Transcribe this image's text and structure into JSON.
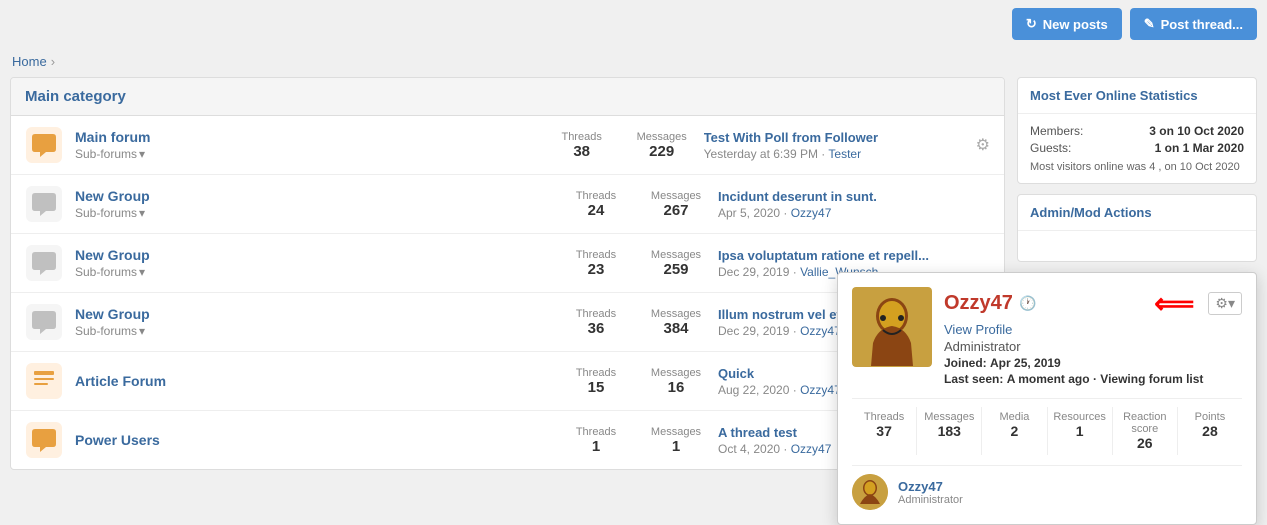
{
  "breadcrumb": {
    "home_label": "Home",
    "separator": "›"
  },
  "buttons": {
    "new_posts": "New posts",
    "post_thread": "Post thread..."
  },
  "category": {
    "title": "Main category",
    "forums": [
      {
        "id": "main-forum",
        "icon_type": "chat-orange",
        "title": "Main forum",
        "has_subforums": true,
        "threads": "38",
        "messages": "229",
        "latest_title": "Test With Poll from Follower",
        "latest_meta": "Yesterday at 6:39 PM",
        "latest_user": "Tester"
      },
      {
        "id": "new-group-1",
        "icon_type": "chat-gray",
        "title": "New Group",
        "has_subforums": true,
        "threads": "24",
        "messages": "267",
        "latest_title": "Incidunt deserunt in sunt.",
        "latest_meta": "Apr 5, 2020",
        "latest_user": "Ozzy47"
      },
      {
        "id": "new-group-2",
        "icon_type": "chat-gray",
        "title": "New Group",
        "has_subforums": true,
        "threads": "23",
        "messages": "259",
        "latest_title": "Ipsa voluptatum ratione et repell...",
        "latest_meta": "Dec 29, 2019",
        "latest_user": "Vallie_Wunsch"
      },
      {
        "id": "new-group-3",
        "icon_type": "chat-gray",
        "title": "New Group",
        "has_subforums": true,
        "threads": "36",
        "messages": "384",
        "latest_title": "Illum nostrum vel et eaque ipsum",
        "latest_meta": "Dec 29, 2019",
        "latest_user": "Ozzy47"
      },
      {
        "id": "article-forum",
        "icon_type": "article-orange",
        "title": "Article Forum",
        "has_subforums": false,
        "threads": "15",
        "messages": "16",
        "latest_title": "Quick",
        "latest_meta": "Aug 22, 2020",
        "latest_user": "Ozzy47"
      },
      {
        "id": "power-users",
        "icon_type": "chat-orange",
        "title": "Power Users",
        "has_subforums": false,
        "threads": "1",
        "messages": "1",
        "latest_title": "A thread test",
        "latest_meta": "Oct 4, 2020",
        "latest_user": "Ozzy47"
      }
    ]
  },
  "sidebar": {
    "online_stats": {
      "title": "Most Ever Online Statistics",
      "members_label": "Members:",
      "members_value": "3 on 10 Oct 2020",
      "guests_label": "Guests:",
      "guests_value": "1 on 1 Mar 2020",
      "most_visitors": "Most visitors online was 4 , on 10 Oct 2020"
    },
    "admin_actions": {
      "title": "Admin/Mod Actions"
    }
  },
  "popup": {
    "username": "Ozzy47",
    "view_profile": "View Profile",
    "role": "Administrator",
    "joined_label": "Joined:",
    "joined_value": "Apr 25, 2019",
    "last_seen_label": "Last seen:",
    "last_seen_value": "A moment ago",
    "last_seen_suffix": "· Viewing forum list",
    "stats": [
      {
        "label": "Threads",
        "value": "37"
      },
      {
        "label": "Messages",
        "value": "183"
      },
      {
        "label": "Media",
        "value": "2"
      },
      {
        "label": "Resources",
        "value": "1"
      },
      {
        "label": "Reaction score",
        "value": "26"
      },
      {
        "label": "Points",
        "value": "28"
      }
    ],
    "footer_user": "Ozzy47",
    "footer_role": "Administrator"
  },
  "labels": {
    "threads": "Threads",
    "messages": "Messages",
    "subforums": "Sub-forums",
    "chevron": "▾"
  }
}
